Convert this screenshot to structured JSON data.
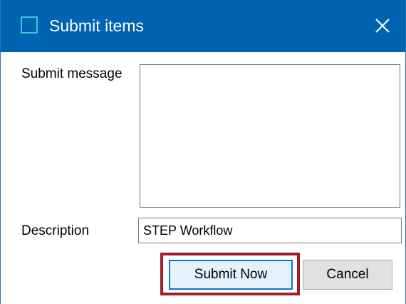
{
  "window": {
    "title": "Submit items",
    "close_icon": "close-icon",
    "app_icon": "window-icon"
  },
  "form": {
    "message_label": "Submit message",
    "message_value": "",
    "description_label": "Description",
    "description_value": "STEP Workflow"
  },
  "buttons": {
    "submit_label": "Submit Now",
    "cancel_label": "Cancel"
  },
  "colors": {
    "titlebar": "#0063b1",
    "highlight": "#a01e2a",
    "primary_border": "#0078d7"
  }
}
